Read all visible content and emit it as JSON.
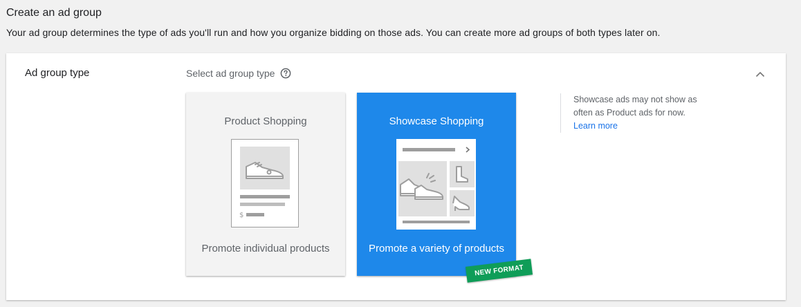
{
  "header": {
    "title": "Create an ad group",
    "subtitle": "Your ad group determines the type of ads you'll run and how you organize bidding on those ads. You can create more ad groups of both types later on."
  },
  "panel": {
    "section_label": "Ad group type",
    "select_label": "Select ad group type",
    "cards": [
      {
        "title": "Product Shopping",
        "caption": "Promote individual products",
        "selected": false
      },
      {
        "title": "Showcase Shopping",
        "caption": "Promote a variety of products",
        "selected": true
      }
    ],
    "badge": "NEW FORMAT",
    "note": {
      "text": "Showcase ads may not show as often as Product ads for now.",
      "link": "Learn more"
    }
  },
  "colors": {
    "selected_card": "#1e88ea",
    "badge": "#0f9d58",
    "link": "#1a73e8"
  },
  "icons": [
    "help-icon",
    "chevron-up-icon",
    "sneaker-icon",
    "boot-icon",
    "heel-icon",
    "chevron-right-icon"
  ]
}
